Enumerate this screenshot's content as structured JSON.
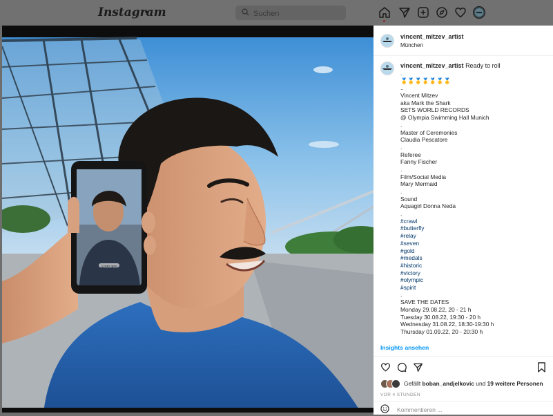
{
  "nav": {
    "logo": "Instagram",
    "search_placeholder": "Suchen",
    "icons": [
      "home-icon",
      "direct-icon",
      "new-post-icon",
      "explore-icon",
      "activity-icon",
      "profile-avatar"
    ]
  },
  "post": {
    "username": "vincent_mitzev_artist",
    "location": "München",
    "caption_first": "Ready to roll",
    "caption_lines": [
      {
        "text": ".",
        "tag": false
      },
      {
        "text": "🥇🥇🥇🥇🥇🥇🥇",
        "tag": false
      },
      {
        "text": "..",
        "tag": false
      },
      {
        "text": "Vincent Mitzev",
        "tag": false
      },
      {
        "text": "aka Mark the Shark",
        "tag": false
      },
      {
        "text": "SETS WORLD RECORDS",
        "tag": false
      },
      {
        "text": "@ Olympia Swimming Hall Munich",
        "tag": false
      },
      {
        "text": ".",
        "tag": false
      },
      {
        "text": "Master of Ceremonies",
        "tag": false
      },
      {
        "text": "Claudia Pescatore",
        "tag": false
      },
      {
        "text": ".",
        "tag": false
      },
      {
        "text": "Referee",
        "tag": false
      },
      {
        "text": "Fanny Fischer",
        "tag": false
      },
      {
        "text": ".",
        "tag": false
      },
      {
        "text": "Film/Social Media",
        "tag": false
      },
      {
        "text": "Mary Mermaid",
        "tag": false
      },
      {
        "text": ".",
        "tag": false
      },
      {
        "text": "Sound",
        "tag": false
      },
      {
        "text": "Aquagirl Donna Neda",
        "tag": false
      },
      {
        "text": ".",
        "tag": false
      },
      {
        "text": "#crawl",
        "tag": true
      },
      {
        "text": "#butterfly",
        "tag": true
      },
      {
        "text": "#relay",
        "tag": true
      },
      {
        "text": "#seven",
        "tag": true
      },
      {
        "text": "#gold",
        "tag": true
      },
      {
        "text": "#medals",
        "tag": true
      },
      {
        "text": "#historic",
        "tag": true
      },
      {
        "text": "#victory",
        "tag": true
      },
      {
        "text": "#olympic",
        "tag": true
      },
      {
        "text": "#spirit",
        "tag": true
      },
      {
        "text": ".",
        "tag": false
      },
      {
        "text": "SAVE THE DATES",
        "tag": false
      },
      {
        "text": "Monday 29.08.22, 20 - 21 h",
        "tag": false
      },
      {
        "text": "Tuesday 30.08.22, 19:30 - 20 h",
        "tag": false
      },
      {
        "text": "Wednesday 31.08.22, 18:30-19:30 h",
        "tag": false
      },
      {
        "text": "Thursday 01.09.22, 20 - 20:30 h",
        "tag": false
      }
    ],
    "insights_label": "Insights ansehen",
    "likes": {
      "prefix": "Gefällt",
      "user": "boban_andjelkovic",
      "middle": "und",
      "others": "19 weitere Personen"
    },
    "timestamp": "VOR 4 STUNDEN",
    "comment_placeholder": "Kommentieren ...",
    "phone_caption": "Q.mark rgeld"
  },
  "colors": {
    "link_blue": "#0095f6",
    "hashtag": "#00376b",
    "text": "#262626",
    "muted": "#8e8e8e"
  }
}
